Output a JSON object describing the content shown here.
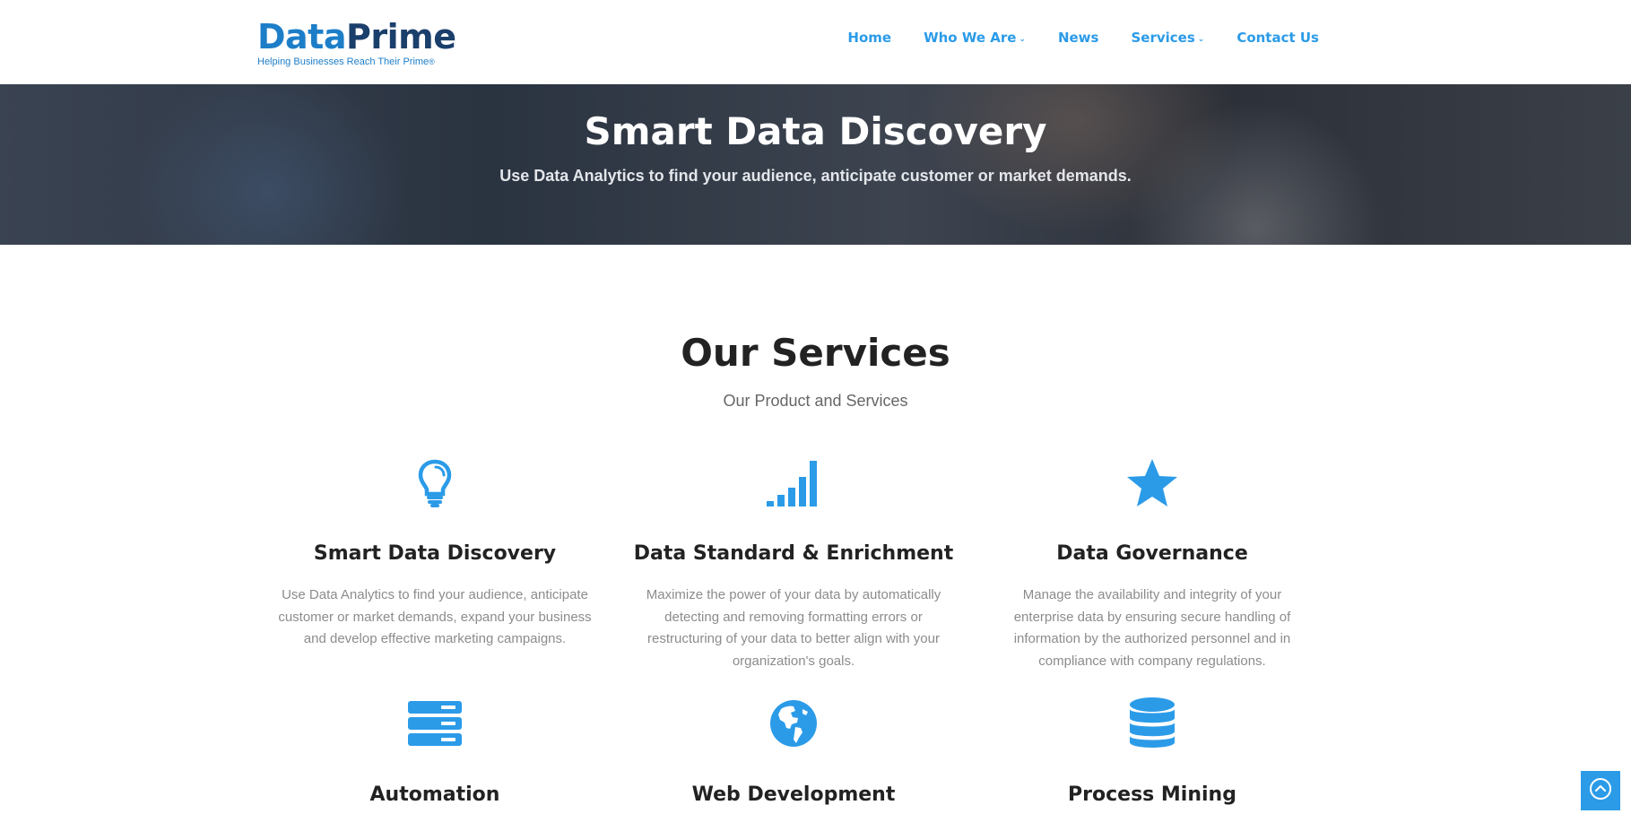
{
  "brand": {
    "name_part1": "Data",
    "name_part2": "Prime",
    "tagline": "Helping Businesses Reach Their Prime",
    "tagline_mark": "®"
  },
  "nav": {
    "items": [
      {
        "label": "Home",
        "has_dropdown": false
      },
      {
        "label": "Who We Are",
        "has_dropdown": true
      },
      {
        "label": "News",
        "has_dropdown": false
      },
      {
        "label": "Services",
        "has_dropdown": true
      },
      {
        "label": "Contact Us",
        "has_dropdown": false
      }
    ]
  },
  "hero": {
    "title": "Smart Data Discovery",
    "subtitle": "Use Data Analytics to find your audience, anticipate customer or market demands."
  },
  "services": {
    "title": "Our Services",
    "subtitle": "Our Product and Services",
    "items": [
      {
        "icon": "lightbulb-icon",
        "title": "Smart Data Discovery",
        "description": "Use Data Analytics to find your audience, anticipate customer or market demands, expand your business and develop effective marketing campaigns."
      },
      {
        "icon": "signal-bars-icon",
        "title": "Data Standard & Enrichment",
        "description": "Maximize the power of your data by automatically detecting and removing formatting errors or restructuring of your data to better align with your organization's goals."
      },
      {
        "icon": "star-icon",
        "title": "Data Governance",
        "description": "Manage the availability and integrity of your enterprise data by ensuring secure handling of information by the authorized personnel and in compliance with company regulations."
      },
      {
        "icon": "server-icon",
        "title": "Automation",
        "description": ""
      },
      {
        "icon": "globe-icon",
        "title": "Web Development",
        "description": ""
      },
      {
        "icon": "database-icon",
        "title": "Process Mining",
        "description": ""
      }
    ]
  },
  "colors": {
    "accent": "#2b9be8",
    "brand_light": "#1d7ec8",
    "brand_dark": "#1b3f6b",
    "heading": "#222222",
    "body_text": "#8c8c8c"
  },
  "back_to_top": {
    "icon": "chevron-up-circle-icon"
  }
}
